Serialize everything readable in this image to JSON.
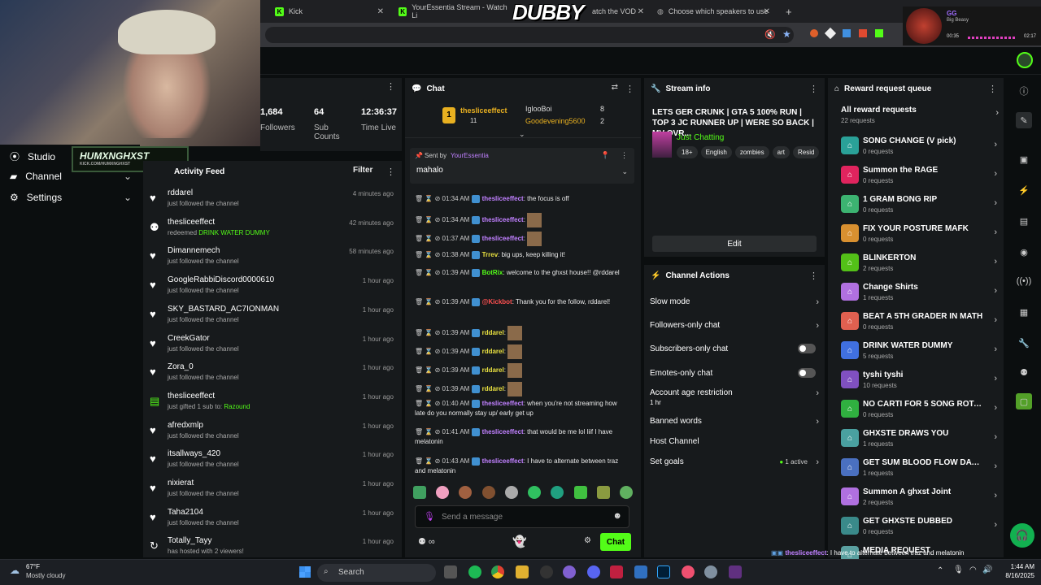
{
  "browser": {
    "tabs": [
      {
        "title": "Kick",
        "x": 0
      },
      {
        "title": "YourEssentia Stream - Watch Li"
      },
      {
        "title": "atch the VOD"
      },
      {
        "title": "Choose which speakers to use"
      }
    ],
    "new_tab": "+"
  },
  "overlay": {
    "brand": "DUBBY",
    "streamer_tag": "HUMXNGHXST",
    "streamer_url": "KICK.COM/HUMXNGHXST",
    "song_title": "GG",
    "song_artist": "Big Beasy",
    "song_elapsed": "00:35",
    "song_total": "02:17"
  },
  "leftnav": {
    "items": [
      {
        "label": "Studio"
      },
      {
        "label": "Channel"
      },
      {
        "label": "Settings"
      }
    ]
  },
  "stats": {
    "followers_value": "1,684",
    "followers_label": "Followers",
    "subs_value": "64",
    "subs_label": "Sub Counts",
    "time_value": "12:36:37",
    "time_label": "Time Live"
  },
  "feed": {
    "title": "Activity Feed",
    "filter": "Filter",
    "items": [
      {
        "name": "rddarel",
        "action": "just followed the channel",
        "time": "4 minutes ago",
        "highlight": ""
      },
      {
        "name": "thesliceeffect",
        "action": "redeemed ",
        "time": "42 minutes ago",
        "highlight": "DRINK WATER DUMMY"
      },
      {
        "name": "Dimannemech",
        "action": "just followed the channel",
        "time": "58 minutes ago",
        "highlight": ""
      },
      {
        "name": "GoogleRabbiDiscord0000610",
        "action": "just followed the channel",
        "time": "1 hour ago",
        "highlight": ""
      },
      {
        "name": "SKY_BASTARD_AC7IONMAN",
        "action": "just followed the channel",
        "time": "1 hour ago",
        "highlight": ""
      },
      {
        "name": "CreekGator",
        "action": "just followed the channel",
        "time": "1 hour ago",
        "highlight": ""
      },
      {
        "name": "Zora_0",
        "action": "just followed the channel",
        "time": "1 hour ago",
        "highlight": ""
      },
      {
        "name": "thesliceeffect",
        "action": "just gifted 1 sub to: ",
        "time": "1 hour ago",
        "highlight": "Razound"
      },
      {
        "name": "afredxmlp",
        "action": "just followed the channel",
        "time": "1 hour ago",
        "highlight": ""
      },
      {
        "name": "itsallways_420",
        "action": "just followed the channel",
        "time": "1 hour ago",
        "highlight": ""
      },
      {
        "name": "nixierat",
        "action": "just followed the channel",
        "time": "1 hour ago",
        "highlight": ""
      },
      {
        "name": "Taha2104",
        "action": "just followed the channel",
        "time": "1 hour ago",
        "highlight": ""
      },
      {
        "name": "Totally_Tayy",
        "action": "has hosted with 2 viewers!",
        "time": "1 hour ago",
        "highlight": ""
      }
    ]
  },
  "chat": {
    "title": "Chat",
    "leader": {
      "rank": "1",
      "name": "thesliceeffect",
      "count": "11"
    },
    "leader2": [
      {
        "name": "IglooBoi",
        "count": "8"
      },
      {
        "name": "Goodevening5600",
        "count": "2"
      }
    ],
    "pinned": {
      "sent_by_label": "Sent by",
      "sender": "YourEssentia",
      "text": "mahalo"
    },
    "messages": [
      {
        "time": "01:34 AM",
        "user": "thesliceeffect",
        "text": "the focus is off"
      },
      {
        "time": "01:34 AM",
        "user": "thesliceeffect",
        "text": ""
      },
      {
        "time": "01:37 AM",
        "user": "thesliceeffect",
        "text": ""
      },
      {
        "time": "01:38 AM",
        "user": "Trrev",
        "text": "big ups, keep killing it!"
      },
      {
        "time": "01:39 AM",
        "user": "BotRix",
        "text": "welcome to the ghxst house!! @rddarel"
      },
      {
        "time": "01:39 AM",
        "user": "@Kickbot",
        "text": "Thank you for the follow, rddarel!"
      },
      {
        "time": "01:39 AM",
        "user": "rddarel",
        "text": ""
      },
      {
        "time": "01:39 AM",
        "user": "rddarel",
        "text": ""
      },
      {
        "time": "01:39 AM",
        "user": "rddarel",
        "text": ""
      },
      {
        "time": "01:39 AM",
        "user": "rddarel",
        "text": ""
      },
      {
        "time": "01:40 AM",
        "user": "thesliceeffect",
        "text": "when you're not streaming how late do you normally stay up/ early get up"
      },
      {
        "time": "01:41 AM",
        "user": "thesliceeffect",
        "text": "that would be me lol liif I have melatonin"
      },
      {
        "time": "01:43 AM",
        "user": "thesliceeffect",
        "text": "I have to alternate between traz and melatonin"
      }
    ],
    "input_placeholder": "Send a message",
    "send_label": "Chat"
  },
  "stream_info": {
    "title": "Stream info",
    "stream_title": "LETS GER CRUNK | GTA 5 100% RUN | TOP 3 JC RUNNER UP | WERE SO BACK | MV OVR...",
    "category": "Just Chatting",
    "tags": [
      "18+",
      "English",
      "zombies",
      "art",
      "Resid"
    ],
    "edit_label": "Edit"
  },
  "channel_actions": {
    "title": "Channel Actions",
    "items": [
      {
        "label": "Slow mode",
        "control": "chevron"
      },
      {
        "label": "Followers-only chat",
        "control": "chevron"
      },
      {
        "label": "Subscribers-only chat",
        "control": "toggle"
      },
      {
        "label": "Emotes-only chat",
        "control": "toggle"
      },
      {
        "label": "Account age restriction",
        "sub": "1 hr",
        "control": "chevron"
      },
      {
        "label": "Banned words",
        "control": "chevron"
      },
      {
        "label": "Host Channel",
        "control": "none"
      },
      {
        "label": "Set goals",
        "status": "1 active",
        "control": "chevron"
      }
    ]
  },
  "rewards": {
    "title": "Reward request queue",
    "all_label": "All reward requests",
    "all_count": "22 requests",
    "items": [
      {
        "name": "SONG CHANGE (V pick)",
        "count": "0 requests",
        "color": "#2aa198"
      },
      {
        "name": "Summon the RAGE",
        "count": "0 requests",
        "color": "#e0245e"
      },
      {
        "name": "1 GRAM BONG RIP",
        "count": "0 requests",
        "color": "#3cb371"
      },
      {
        "name": "FIX YOUR POSTURE MAFK",
        "count": "0 requests",
        "color": "#d89030"
      },
      {
        "name": "BLINKERTON",
        "count": "2 requests",
        "color": "#53c018"
      },
      {
        "name": "Change Shirts",
        "count": "1 requests",
        "color": "#b070e0"
      },
      {
        "name": "BEAT A 5TH GRADER IN MATH",
        "count": "0 requests",
        "color": "#e06050"
      },
      {
        "name": "DRINK WATER DUMMY",
        "count": "5 requests",
        "color": "#4070e0"
      },
      {
        "name": "tyshi tyshi",
        "count": "10 requests",
        "color": "#8050c0"
      },
      {
        "name": "NO CARTI FOR 5 SONG ROTA...",
        "count": "0 requests",
        "color": "#30b040"
      },
      {
        "name": "GHXSTE DRAWS YOU",
        "count": "1 requests",
        "color": "#4aa0a0"
      },
      {
        "name": "GET SUM BLOOD FLOW DAW...",
        "count": "1 requests",
        "color": "#4a70c0"
      },
      {
        "name": "Summon A ghxst Joint",
        "count": "2 requests",
        "color": "#b070e0"
      },
      {
        "name": "GET GHXSTE DUBBED",
        "count": "0 requests",
        "color": "#3a8a8a"
      },
      {
        "name": "MEDIA REQUEST",
        "count": "",
        "color": "#5aa0a0"
      }
    ]
  },
  "ticker": {
    "user": "thesliceeffect",
    "text": ": I have to alternate between traz and melatonin"
  },
  "taskbar": {
    "weather_temp": "67°F",
    "weather_desc": "Mostly cloudy",
    "search": "Search",
    "time": "1:44 AM",
    "date": "8/16/2025"
  }
}
